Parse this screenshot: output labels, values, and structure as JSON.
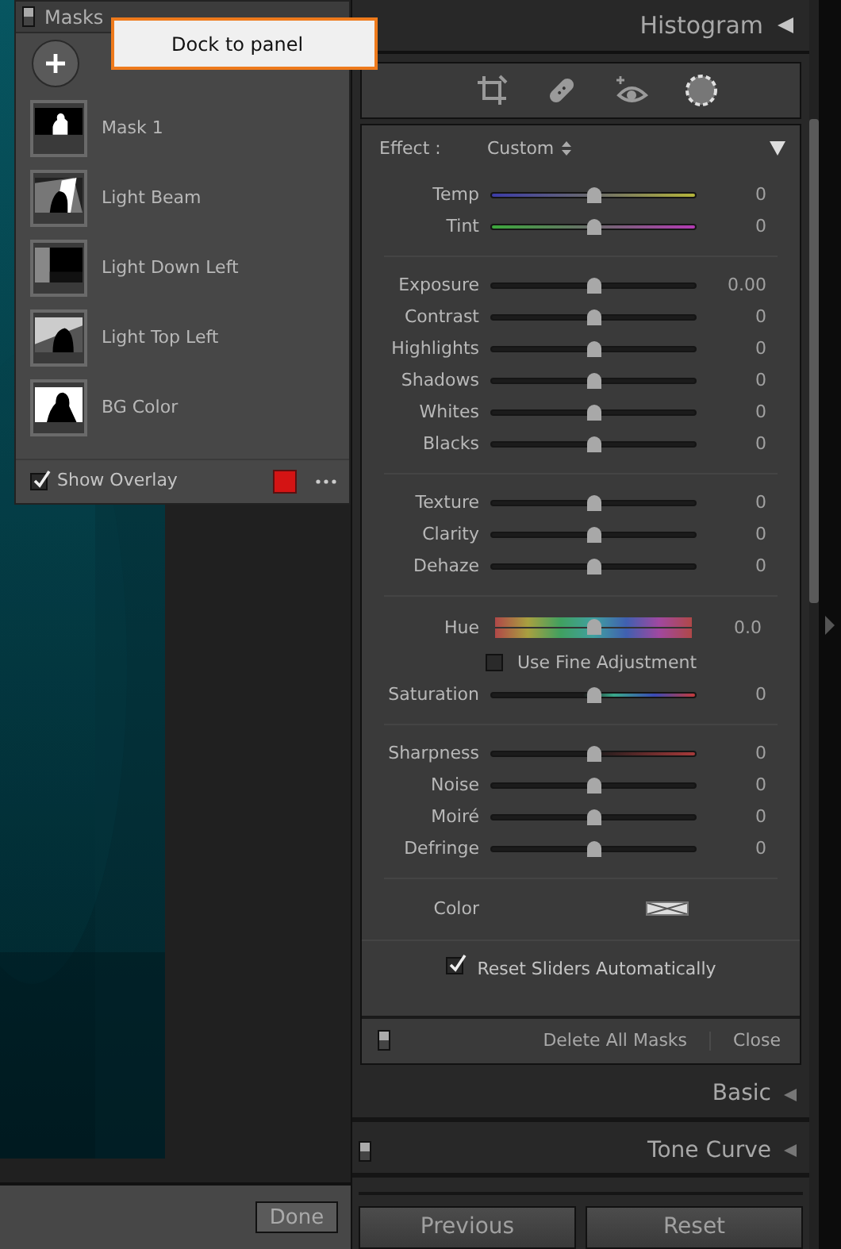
{
  "masks_panel": {
    "title": "Masks",
    "switch_on": true,
    "masks": [
      {
        "name": "Mask 1",
        "kind": "subject"
      },
      {
        "name": "Light Beam",
        "kind": "beam"
      },
      {
        "name": "Light Down Left",
        "kind": "corner"
      },
      {
        "name": "Light Top Left",
        "kind": "top"
      },
      {
        "name": "BG Color",
        "kind": "background"
      }
    ],
    "show_overlay": {
      "label": "Show Overlay",
      "checked": true,
      "color": "#d41414"
    }
  },
  "popup_menu": {
    "items": [
      "Dock to panel"
    ]
  },
  "done_button": "Done",
  "histogram_header": "Histogram",
  "tools": [
    {
      "kind": "crop",
      "selected": false
    },
    {
      "kind": "heal",
      "selected": false
    },
    {
      "kind": "redeye",
      "selected": false
    },
    {
      "kind": "mask",
      "selected": true
    }
  ],
  "effect": {
    "label": "Effect :",
    "value": "Custom"
  },
  "groups": [
    [
      {
        "kind": "temp",
        "label": "Temp",
        "value": "0",
        "level": 0.5
      },
      {
        "kind": "tint",
        "label": "Tint",
        "value": "0",
        "level": 0.5
      }
    ],
    [
      {
        "kind": "slider",
        "label": "Exposure",
        "value": "0.00",
        "level": 0.5
      },
      {
        "kind": "slider",
        "label": "Contrast",
        "value": "0",
        "level": 0.5
      },
      {
        "kind": "slider",
        "label": "Highlights",
        "value": "0",
        "level": 0.5
      },
      {
        "kind": "slider",
        "label": "Shadows",
        "value": "0",
        "level": 0.5
      },
      {
        "kind": "slider",
        "label": "Whites",
        "value": "0",
        "level": 0.5
      },
      {
        "kind": "slider",
        "label": "Blacks",
        "value": "0",
        "level": 0.5
      }
    ],
    [
      {
        "kind": "slider",
        "label": "Texture",
        "value": "0",
        "level": 0.5
      },
      {
        "kind": "slider",
        "label": "Clarity",
        "value": "0",
        "level": 0.5
      },
      {
        "kind": "slider",
        "label": "Dehaze",
        "value": "0",
        "level": 0.5
      }
    ],
    [
      {
        "kind": "hue",
        "label": "Hue",
        "value": "0.0",
        "level": 0.5
      },
      {
        "kind": "checkbox",
        "label": "Use Fine Adjustment",
        "checked": false
      },
      {
        "kind": "saturation",
        "label": "Saturation",
        "value": "0",
        "level": 0.5
      }
    ],
    [
      {
        "kind": "sharpness",
        "label": "Sharpness",
        "value": "0",
        "level": 0.5
      },
      {
        "kind": "slider",
        "label": "Noise",
        "value": "0",
        "level": 0.5
      },
      {
        "kind": "slider",
        "label": "Moiré",
        "value": "0",
        "level": 0.5
      },
      {
        "kind": "slider",
        "label": "Defringe",
        "value": "0",
        "level": 0.5
      }
    ],
    [
      {
        "kind": "color",
        "label": "Color"
      }
    ]
  ],
  "reset_sliders": {
    "label": "Reset Sliders Automatically",
    "checked": true
  },
  "footer": {
    "switch_on": true,
    "delete": "Delete All Masks",
    "close": "Close"
  },
  "sections": [
    {
      "title": "Basic"
    },
    {
      "title": "Tone Curve",
      "switch_on": true
    }
  ],
  "buttons": [
    "Previous",
    "Reset"
  ]
}
